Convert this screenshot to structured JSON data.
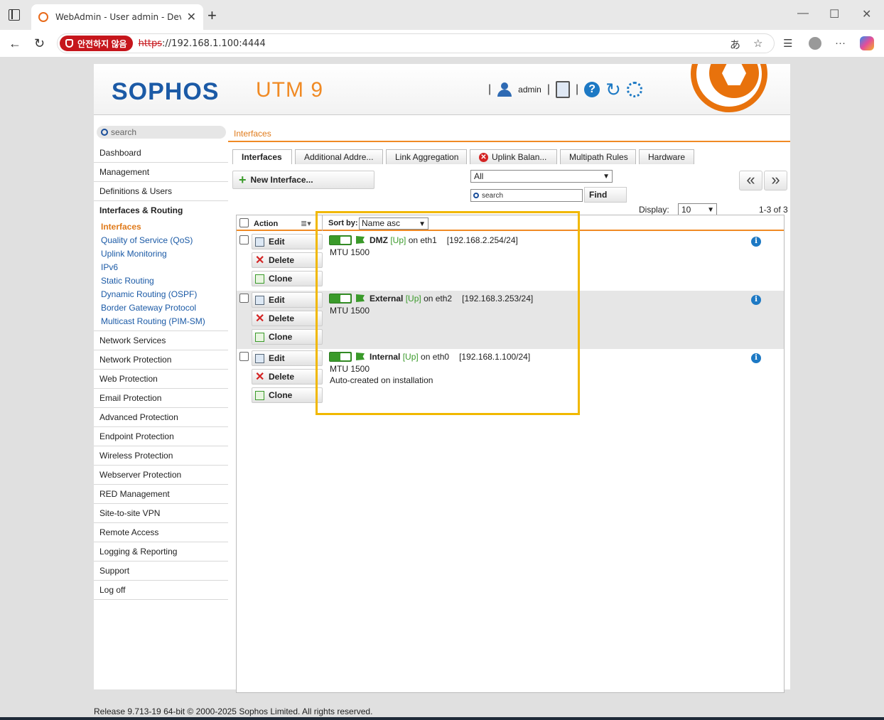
{
  "browser": {
    "tab_title": "WebAdmin - User admin - Device",
    "tab_close": "✕",
    "new_tab": "+",
    "unsafe_label": "안전하지 않음",
    "url_scheme": "https",
    "url_rest": "://192.168.1.100:4444"
  },
  "header": {
    "logo": "SOPHOS",
    "product": "UTM 9",
    "user": "admin",
    "accent_color": "#f08a24",
    "brand_color": "#1b5aa6"
  },
  "sidebar": {
    "search_placeholder": "search",
    "items_before": [
      "Dashboard",
      "Management",
      "Definitions & Users"
    ],
    "section": "Interfaces & Routing",
    "sub_items": [
      "Interfaces",
      "Quality of Service (QoS)",
      "Uplink Monitoring",
      "IPv6",
      "Static Routing",
      "Dynamic Routing (OSPF)",
      "Border Gateway Protocol",
      "Multicast Routing (PIM-SM)"
    ],
    "items_after": [
      "Network Services",
      "Network Protection",
      "Web Protection",
      "Email Protection",
      "Advanced Protection",
      "Endpoint Protection",
      "Wireless Protection",
      "Webserver Protection",
      "RED Management",
      "Site-to-site VPN",
      "Remote Access",
      "Logging & Reporting",
      "Support",
      "Log off"
    ]
  },
  "breadcrumb": "Interfaces",
  "tabs": [
    "Interfaces",
    "Additional Addre...",
    "Link Aggregation",
    "Uplink Balan...",
    "Multipath Rules",
    "Hardware"
  ],
  "toolbar": {
    "new_interface": "New Interface...",
    "filter_value": "All",
    "search_placeholder": "search",
    "find": "Find",
    "prev": "«",
    "next": "»",
    "display_label": "Display:",
    "display_value": "10",
    "count": "1-3 of 3"
  },
  "list": {
    "action_header": "Action",
    "sort_label": "Sort by:",
    "sort_value": "Name asc",
    "edit": "Edit",
    "delete": "Delete",
    "clone": "Clone",
    "rows": [
      {
        "name": "DMZ",
        "status": "[Up]",
        "on": "on eth1",
        "address": "[192.168.2.254/24]",
        "mtu": "MTU 1500",
        "comment": ""
      },
      {
        "name": "External",
        "status": "[Up]",
        "on": "on eth2",
        "address": "[192.168.3.253/24]",
        "mtu": "MTU 1500",
        "comment": ""
      },
      {
        "name": "Internal",
        "status": "[Up]",
        "on": "on eth0",
        "address": "[192.168.1.100/24]",
        "mtu": "MTU 1500",
        "comment": "Auto-created on installation"
      }
    ]
  },
  "footer": "Release 9.713-19 64-bit  © 2000-2025 Sophos Limited. All rights reserved."
}
